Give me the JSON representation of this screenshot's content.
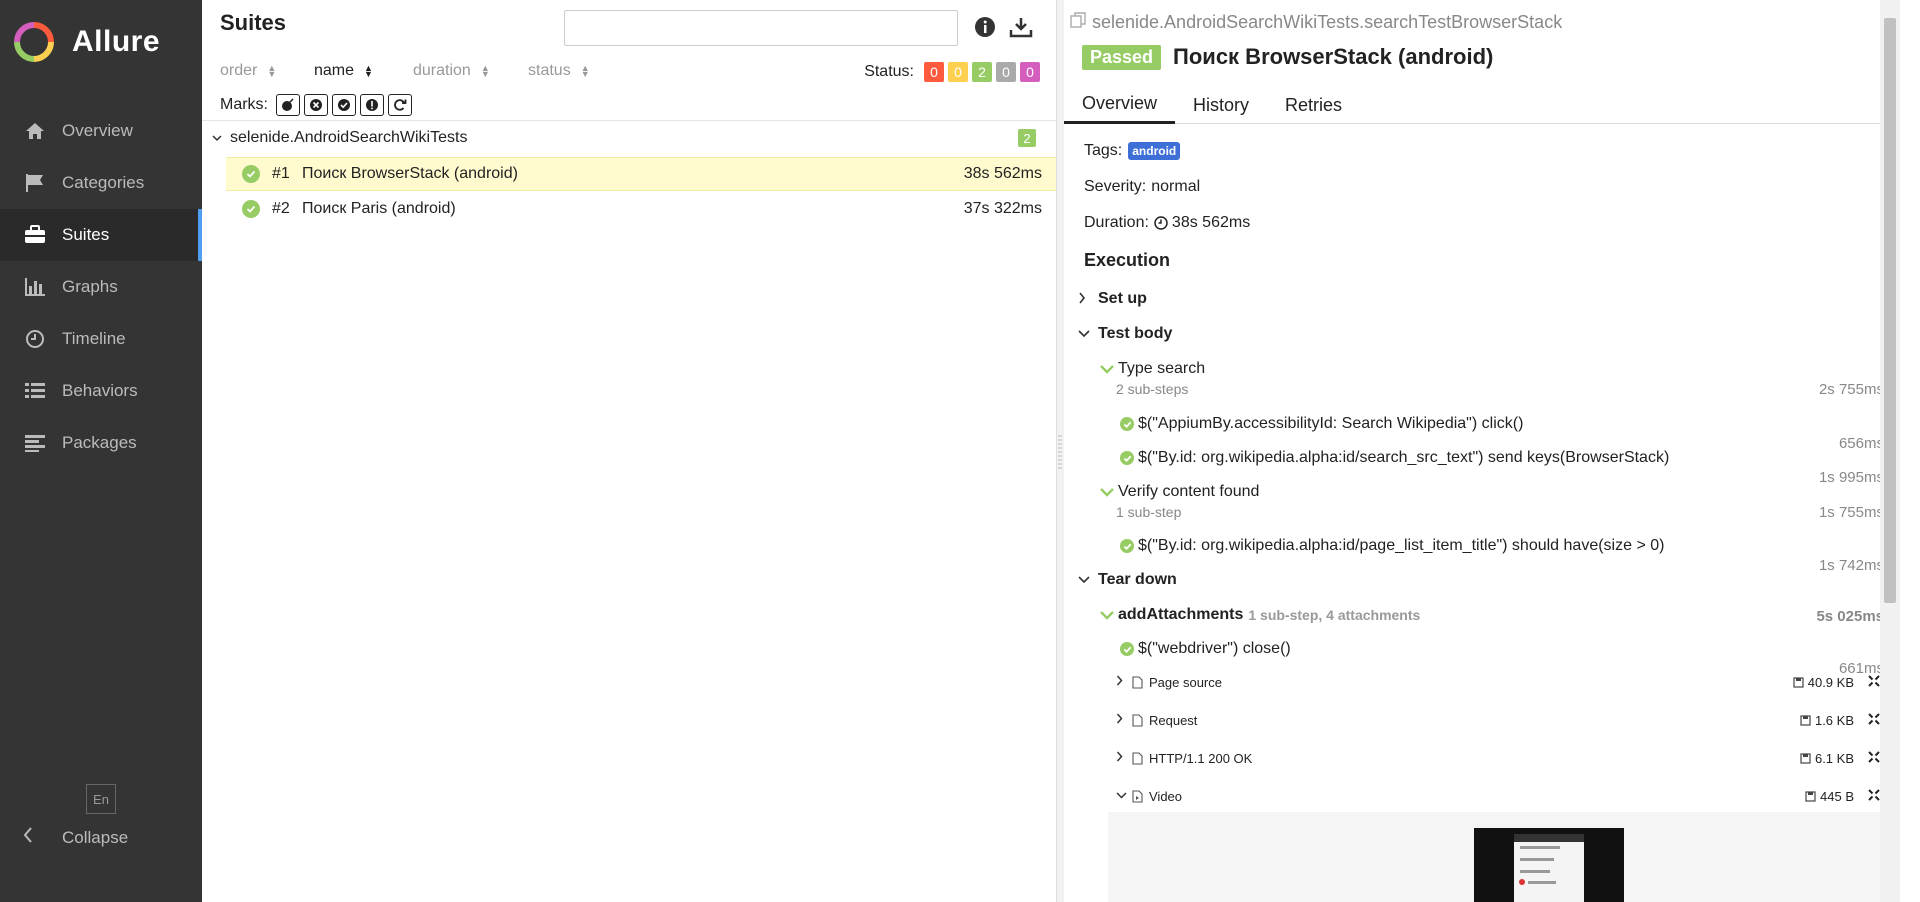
{
  "app": {
    "name": "Allure"
  },
  "sidebar": {
    "items": [
      {
        "label": "Overview",
        "icon": "home-icon"
      },
      {
        "label": "Categories",
        "icon": "flag-icon"
      },
      {
        "label": "Suites",
        "icon": "briefcase-icon"
      },
      {
        "label": "Graphs",
        "icon": "bar-chart-icon"
      },
      {
        "label": "Timeline",
        "icon": "clock-icon"
      },
      {
        "label": "Behaviors",
        "icon": "list-icon"
      },
      {
        "label": "Packages",
        "icon": "align-left-icon"
      }
    ],
    "active": "Suites",
    "language": "En",
    "collapse_label": "Collapse"
  },
  "suites": {
    "title": "Suites",
    "search": {
      "value": "",
      "placeholder": ""
    },
    "sort": {
      "order": "order",
      "name": "name",
      "duration": "duration",
      "status": "status"
    },
    "status_label": "Status:",
    "status_counts": [
      {
        "value": "0",
        "color": "#fd5a3e"
      },
      {
        "value": "0",
        "color": "#ffd050"
      },
      {
        "value": "2",
        "color": "#97cc64"
      },
      {
        "value": "0",
        "color": "#aaaaaa"
      },
      {
        "value": "0",
        "color": "#d35ebe"
      }
    ],
    "marks_label": "Marks:",
    "group": {
      "name": "selenide.AndroidSearchWikiTests",
      "count": "2"
    },
    "rows": [
      {
        "num": "#1",
        "name": "Поиск BrowserStack (android)",
        "duration": "38s 562ms"
      },
      {
        "num": "#2",
        "name": "Поиск Paris (android)",
        "duration": "37s 322ms"
      }
    ]
  },
  "detail": {
    "fullname": "selenide.AndroidSearchWikiTests.searchTestBrowserStack",
    "status": "Passed",
    "title": "Поиск BrowserStack (android)",
    "tabs": [
      "Overview",
      "History",
      "Retries"
    ],
    "tags_label": "Tags:",
    "tag": "android",
    "severity_label": "Severity:",
    "severity": "normal",
    "duration_label": "Duration:",
    "duration": "38s 562ms",
    "execution_label": "Execution",
    "setup_label": "Set up",
    "testbody_label": "Test body",
    "teardown_label": "Tear down",
    "steps": {
      "type_search": {
        "name": "Type search",
        "sub": "2 sub-steps",
        "dur": "2s 755ms"
      },
      "click": {
        "name": "$(\"AppiumBy.accessibilityId: Search Wikipedia\") click()",
        "dur": "656ms"
      },
      "send_keys": {
        "name": "$(\"By.id: org.wikipedia.alpha:id/search_src_text\") send keys(BrowserStack)",
        "dur": "1s 995ms"
      },
      "verify": {
        "name": "Verify content found",
        "sub": "1 sub-step",
        "dur": "1s 755ms"
      },
      "should": {
        "name": "$(\"By.id: org.wikipedia.alpha:id/page_list_item_title\") should have(size > 0)",
        "dur": "1s 742ms"
      },
      "add_att": {
        "name": "addAttachments",
        "sub": "1 sub-step, 4 attachments",
        "dur": "5s 025ms"
      },
      "close": {
        "name": "$(\"webdriver\") close()",
        "dur": "661ms"
      }
    },
    "attachments": [
      {
        "name": "Page source",
        "size": "40.9 KB"
      },
      {
        "name": "Request",
        "size": "1.6 KB"
      },
      {
        "name": "HTTP/1.1 200 OK",
        "size": "6.1 KB"
      },
      {
        "name": "Video",
        "size": "445 B"
      }
    ]
  }
}
